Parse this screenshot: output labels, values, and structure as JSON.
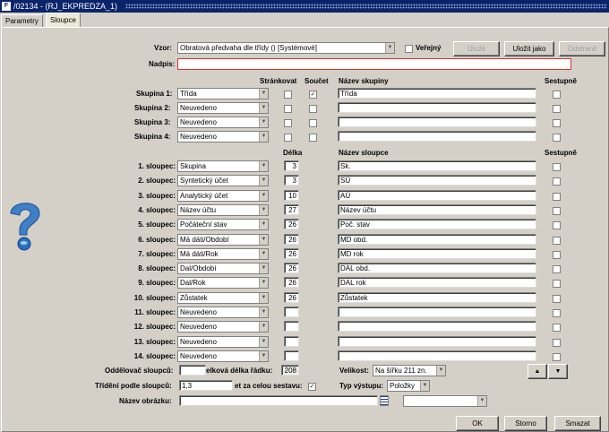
{
  "window": {
    "title": "/02134 - (RJ_EKPREDZA_1)"
  },
  "tabs": [
    "Parametry",
    "Sloupce"
  ],
  "top": {
    "vzor_label": "Vzor:",
    "vzor_value": "Obratová předvaha dle třídy   ()   [Systémové]",
    "verejny_label": "Veřejný",
    "btn_ulozit": "Uložit",
    "btn_ulozit_jako": "Uložit jako",
    "btn_odstranit": "Odstranit",
    "nadpis_label": "Nadpis:",
    "nadpis_value": ""
  },
  "groups": {
    "hdr_strankovat": "Stránkovat",
    "hdr_soucet": "Součet",
    "hdr_nazev": "Název skupiny",
    "hdr_sestupne": "Sestupně",
    "rows": [
      {
        "label": "Skupina 1:",
        "value": "Třída",
        "strankovat": false,
        "soucet": true,
        "nazev": "Třída",
        "sestupne": false
      },
      {
        "label": "Skupina 2:",
        "value": "Neuvedeno",
        "strankovat": false,
        "soucet": false,
        "nazev": "",
        "sestupne": false
      },
      {
        "label": "Skupina 3:",
        "value": "Neuvedeno",
        "strankovat": false,
        "soucet": false,
        "nazev": "",
        "sestupne": false
      },
      {
        "label": "Skupina 4:",
        "value": "Neuvedeno",
        "strankovat": false,
        "soucet": false,
        "nazev": "",
        "sestupne": false
      }
    ]
  },
  "columns": {
    "hdr_delka": "Délka",
    "hdr_nazev": "Název sloupce",
    "hdr_sestupne": "Sestupně",
    "rows": [
      {
        "label": "1. sloupec:",
        "value": "Skupina",
        "delka": "3",
        "nazev": "Sk."
      },
      {
        "label": "2. sloupec:",
        "value": "Syntetický účet",
        "delka": "3",
        "nazev": "SÚ"
      },
      {
        "label": "3. sloupec:",
        "value": "Analytický účet",
        "delka": "10",
        "nazev": "AÚ"
      },
      {
        "label": "4. sloupec:",
        "value": "Název účtu",
        "delka": "27",
        "nazev": "Název účtu"
      },
      {
        "label": "5. sloupec:",
        "value": "Počáteční stav",
        "delka": "26",
        "nazev": "Poč. stav"
      },
      {
        "label": "6. sloupec:",
        "value": "Má dáti/Období",
        "delka": "26",
        "nazev": "MD obd."
      },
      {
        "label": "7. sloupec:",
        "value": "Má dáti/Rok",
        "delka": "26",
        "nazev": "MD rok"
      },
      {
        "label": "8. sloupec:",
        "value": "Dal/Období",
        "delka": "26",
        "nazev": "DAL obd."
      },
      {
        "label": "9. sloupec:",
        "value": "Dal/Rok",
        "delka": "26",
        "nazev": "DAL rok"
      },
      {
        "label": "10. sloupec:",
        "value": "Zůstatek",
        "delka": "26",
        "nazev": "Zůstatek"
      },
      {
        "label": "11. sloupec:",
        "value": "Neuvedeno",
        "delka": "",
        "nazev": ""
      },
      {
        "label": "12. sloupec:",
        "value": "Neuvedeno",
        "delka": "",
        "nazev": ""
      },
      {
        "label": "13. sloupec:",
        "value": "Neuvedeno",
        "delka": "",
        "nazev": ""
      },
      {
        "label": "14. sloupec:",
        "value": "Neuvedeno",
        "delka": "",
        "nazev": ""
      }
    ]
  },
  "bottom": {
    "oddelovac_label": "Oddělovač sloupců:",
    "oddelovac_value": "",
    "celkova_label": "elková délka řádku:",
    "celkova_value": "208",
    "velikost_label": "Velikost:",
    "velikost_value": "Na šířku 211 zn.",
    "trideni_label": "Třídění podle sloupců:",
    "trideni_value": "1,3",
    "soucet_label": "et za celou sestavu:",
    "typ_label": "Typ výstupu:",
    "typ_value": "Položky",
    "obrazek_label": "Název obrázku:",
    "obrazek_value": "",
    "btn_ok": "OK",
    "btn_storno": "Storno",
    "btn_smazat": "Smazat"
  }
}
